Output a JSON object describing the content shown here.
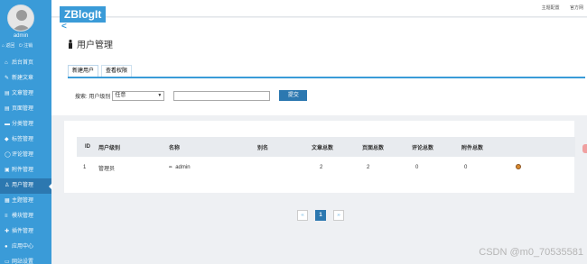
{
  "header": {
    "logo": "ZBlogIt",
    "logo_arrow": "<",
    "links": [
      "主题配置",
      "官方网"
    ]
  },
  "sidebar": {
    "username": "admin",
    "actions": [
      "⌂ 返回",
      "⏻ 注销"
    ],
    "items": [
      {
        "icon": "⌂",
        "label": "后台首页"
      },
      {
        "icon": "✎",
        "label": "新建文章"
      },
      {
        "icon": "▤",
        "label": "文章管理"
      },
      {
        "icon": "▤",
        "label": "页面管理"
      },
      {
        "icon": "▬",
        "label": "分类管理"
      },
      {
        "icon": "◆",
        "label": "标签管理"
      },
      {
        "icon": "◯",
        "label": "评论管理"
      },
      {
        "icon": "▣",
        "label": "附件管理"
      },
      {
        "icon": "♙",
        "label": "用户管理"
      },
      {
        "icon": "▦",
        "label": "主题管理"
      },
      {
        "icon": "≡",
        "label": "模块管理"
      },
      {
        "icon": "✚",
        "label": "插件管理"
      },
      {
        "icon": "●",
        "label": "应用中心"
      },
      {
        "icon": "▭",
        "label": "网站设置"
      }
    ],
    "active_index": 8
  },
  "page": {
    "title": "用户管理",
    "tabs": [
      "新建用户",
      "查看权限"
    ],
    "search": {
      "label": "搜索: 用户级别",
      "select_value": "任意",
      "submit": "提交"
    }
  },
  "table": {
    "headers": [
      "ID",
      "用户级别",
      "名称",
      "别名",
      "文章总数",
      "页面总数",
      "评论总数",
      "附件总数",
      ""
    ],
    "rows": [
      {
        "id": "1",
        "level": "管理员",
        "name": "admin",
        "alias": "",
        "articles": "2",
        "pages": "2",
        "comments": "0",
        "attachments": "0"
      }
    ]
  },
  "pager": {
    "first": "‹‹",
    "current": "1",
    "last": "››"
  },
  "watermark": "CSDN @m0_70535581",
  "colors": {
    "accent": "#3a9bd8",
    "active": "#2c78b0"
  }
}
